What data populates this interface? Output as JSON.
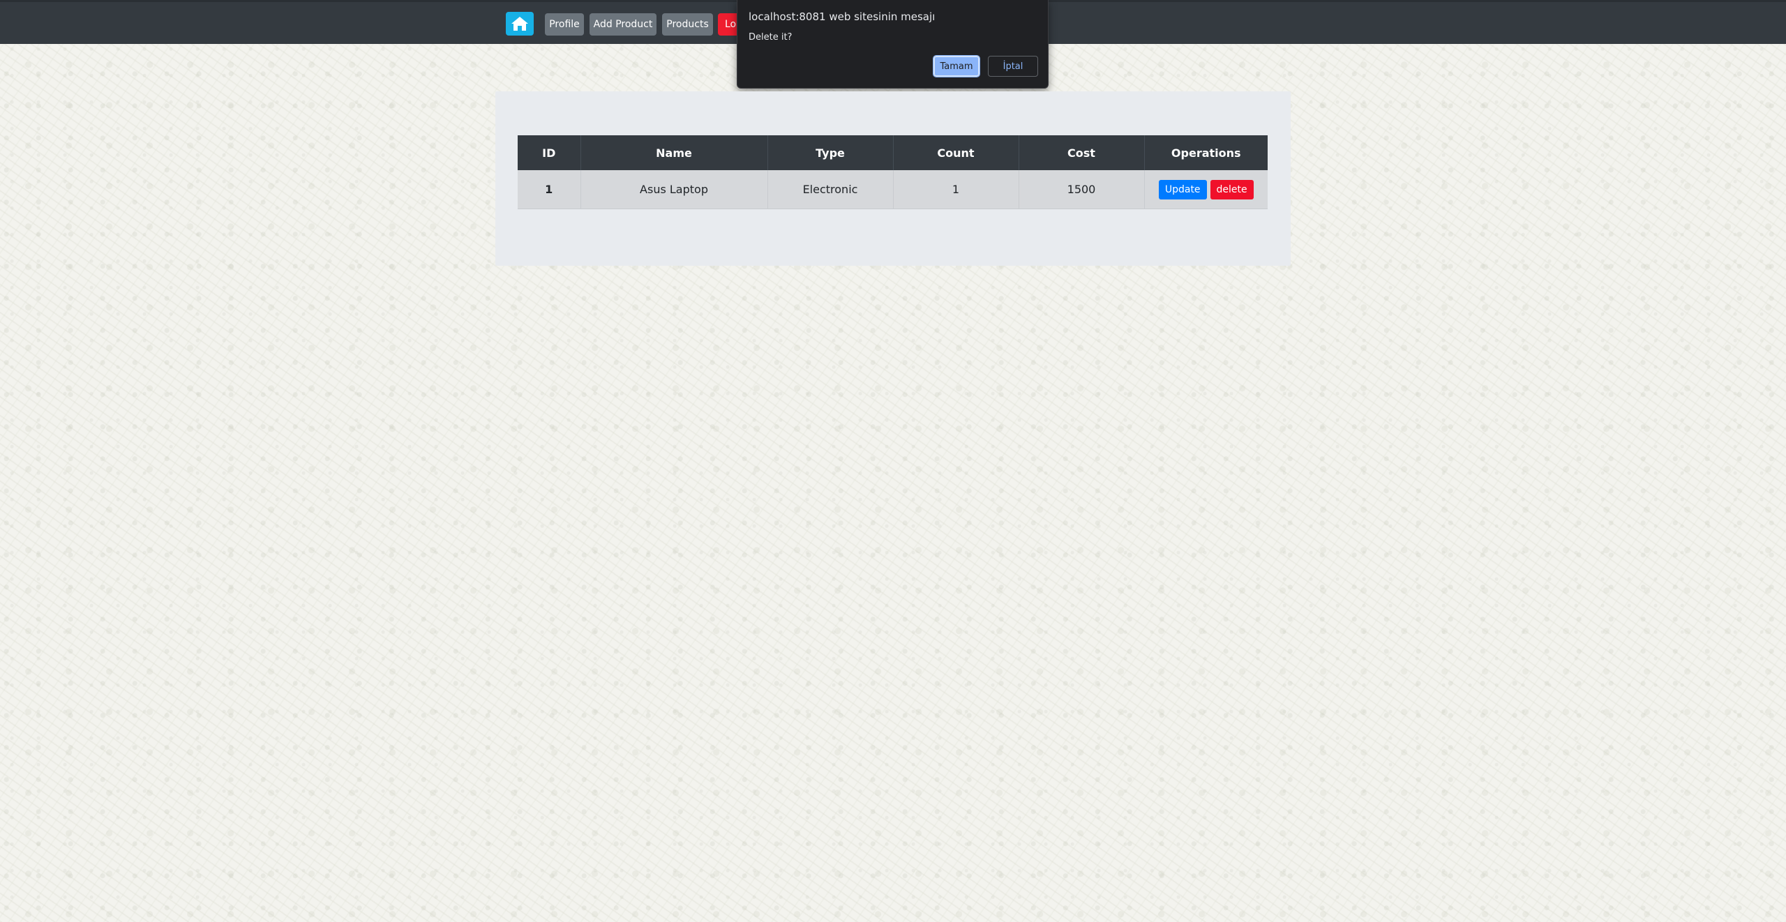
{
  "navbar": {
    "home_icon": "home-icon",
    "profile_label": "Profile",
    "add_product_label": "Add Product",
    "products_label": "Products",
    "logout_label": "Lo"
  },
  "dialog": {
    "title": "localhost:8081 web sitesinin mesajı",
    "message": "Delete it?",
    "ok_label": "Tamam",
    "cancel_label": "İptal"
  },
  "table": {
    "headers": [
      "ID",
      "Name",
      "Type",
      "Count",
      "Cost",
      "Operations"
    ],
    "rows": [
      {
        "id": "1",
        "name": "Asus Laptop",
        "type": "Electronic",
        "count": "1",
        "cost": "1500",
        "update_label": "Update",
        "delete_label": "delete"
      }
    ]
  },
  "colors": {
    "navbar": "#343a40",
    "home_button": "#17b1e6",
    "nav_button": "#6c757d",
    "logout_button": "#ef1d2f",
    "update_button": "#007bff",
    "delete_button": "#f0102a",
    "dialog_bg": "#202124",
    "dialog_accent": "#8ab4f8"
  }
}
